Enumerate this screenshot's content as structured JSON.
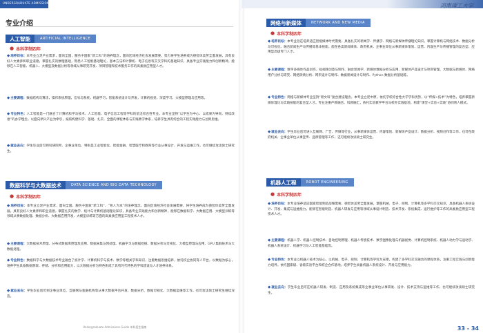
{
  "header": {
    "running_head": "UNDERGRADUATE ADMISSIONS GUIDE",
    "brand": "河南理工大学"
  },
  "left": {
    "page_title": "专业介绍",
    "sections": [
      {
        "title_cn": "人工智能",
        "title_en": "ARTIFICIAL INTELLIGENCE",
        "degree": "本科学制四年",
        "paras": [
          {
            "label": "培养目标：",
            "text": "本专业立足产业需求，面向全国，服务于国家“新工科”的培养理念，面向区域经济社会发展需要，努力将学生培养成为德智体美劳全面发展，具有良好人文素养和职业道德，掌握扎实的数理基础，熟悉人工智能基础理论，基本方法和计算机、电子信息等交叉学科的基础知识，具备专业实践能力和创新精神，能够在人工智能、机器人、大模型及数据分析等领域从事研究开发、项目管理和技术服务工作的高素质应用型人才。"
          },
          {
            "label": "主要课程：",
            "text": "数据结构与算法，操作系统原理，信号与系统，机器学习，智能系统设计与开发，计算机视觉，深度学习，大模型原理与应用等。"
          },
          {
            "label": "专业特色：",
            "text": "人工智能是一门融合了计算机科学与技术、人工智能、电子信息工程等学科的前沿综合性专业。本专业坚持“以学生为中心、以成果为导向、持续改进”的办学理念，以面向新兴产业为牵引，按照构建科学、基础、扎实、全面的课程体系与实践教学体系，培养学生具有综合的工程实践能力与创新思维。"
          },
          {
            "label": "就业去向：",
            "text": "学生毕业后可到科研院所、企事业单位、特别是工业智能化、智能金融、智慧医疗和教育等行业从事设计、开发与运维工作，也可继续攻读硕士研究生。"
          }
        ]
      },
      {
        "title_cn": "数据科学与大数据技术",
        "title_en": "DATA SCIENCE AND BIG DATA TECHNOLOGY",
        "degree": "本科学制四年",
        "paras": [
          {
            "label": "培养目标：",
            "text": "本专业立足产业需求，面向全国，服务于国家“新工科”、“育人为本”的培养理念，面向区域经济社会发展需要，将学生培养成为德智体美劳全面发展，具有良好人文素养和职业道德，掌握扎实的数学、统计与计算机基础理论知识，具备专业实践能力和创新精神，能够在数据科学、大数据应用、大模型训练等领域从事数据处理、数据分析、大数据应用开发、大模型训练等方面的高素质应用型工程技术人才。"
          },
          {
            "label": "主要课程：",
            "text": "大数据技术原理、分布式数据库原理及应用、数据采集与预处理、机器学习与数据挖掘、数据分析与可视化、大模型原理与应用、GPU 集群技术与大数据处理。"
          },
          {
            "label": "专业特色：",
            "text": "数据科学与大数据技术专业融合了统计学、计算机科学与技术、数学等相关学科知识，注重数据思维培养，依托校企协同育人平台，以数据为核心，培养学生具备数据获取、存储、分析和应用能力，以大数据分析为特色形成了具有时代特色的学科建设与人才培养体系。"
          },
          {
            "label": "就业去向：",
            "text": "学生毕业后可到企事业单位、互联网与金融机构等从事大数据平台开发、数据分析、数据可视化、大数据运维等工作，也可攻读硕士研究生继续深造。"
          }
        ]
      }
    ],
    "footer": "Undergraduate Admissions Guide  本科招生指南"
  },
  "right": {
    "sections": [
      {
        "title_cn": "网络与新媒体",
        "title_en": "NETWORK AND NEW MEDIA",
        "degree": "本科学制四年",
        "paras": [
          {
            "label": "培养目标：",
            "text": "本专业旨在培养适应智能媒体时代需要，具备扎实的新闻学、传播学、网络与新媒体传播理论知识，掌握计算机与网络技术、数据分析与可视化、融合新闻生产与传播等基本技能，能在各类新闻媒体、政府机关、企事业单位从事新媒体策划、运营、内容生产与传播管理的复合型、应用型高级专门人才。"
          },
          {
            "label": "主要课程：",
            "text": "数字多媒体作品创作、短视频创意与制作、融合新闻学、新媒体数据分析与应用、新媒体产品设计与项目管理、大数据与新媒体、网络用户分析与研究、网络舆情分析、网页设计与制作、数据新闻设计与制作、Python 数据分析基础等。"
          },
          {
            "label": "专业特色：",
            "text": "网络与新媒体专业坚持“新文科”复合建设理念，本专业立足中原，依托学校综合性大学学科优势，以“传媒+技术”为特色，培养掌握新媒体理论与实践技能的复合型人才。专业注重产教融合、科教融汇，依托实验教学平台与校外实践基地，构建“课堂+实验+实践”协同育人模式。"
          },
          {
            "label": "就业去向：",
            "text": "学生毕业后可进入互联网、广告、传媒等行业，从事新媒体运营、内容策划、新媒体产品设计、数据分析、视频创作等工作，也可在政府机关、企事业单位从事宣传、品牌管理等工作，还可继续攻读硕士研究生。"
          }
        ]
      },
      {
        "title_cn": "机器人工程",
        "title_en": "ROBOT ENGINEERING",
        "degree": "本科学制四年",
        "paras": [
          {
            "label": "培养目标：",
            "text": "本专业培养适应国家智能制造战略需要，德智体美劳全面发展，掌握机械、电子、控制、计算机等多学科交叉知识，具备机器人系统设计、开发、集成与运维能力，能够在智能制造、机器人研发与应用等领域从事设计制造、技术开发、系统集成、运行维护等工作的高素质应用型工程技术人才。"
          },
          {
            "label": "主要课程：",
            "text": "机器人学、机器人控制技术、自动控制原理、机器人传感技术、数字图像处理与机器视觉、计算机控制系统、机器人动力学与运动学、机器人系统设计、机器学习与人工智能基础等。"
          },
          {
            "label": "专业特色：",
            "text": "本专业以机器人技术为核心，以机械、电子、控制、计算机等学科为支撑，构建了多学科交叉融合的课程体系，注重工程实践与创新能力培养，依托国家级、省级实验平台和校企合作基地，培养学生具备机器人系统设计、开发与应用能力。"
          },
          {
            "label": "就业去向：",
            "text": "学生毕业后可在机器人研发、制造、应用及系统集成等企事业单位从事研发、设计、技术支持与运维等工作，也可继续攻读硕士研究生。"
          }
        ]
      }
    ],
    "page_numbers": "33 - 34"
  }
}
